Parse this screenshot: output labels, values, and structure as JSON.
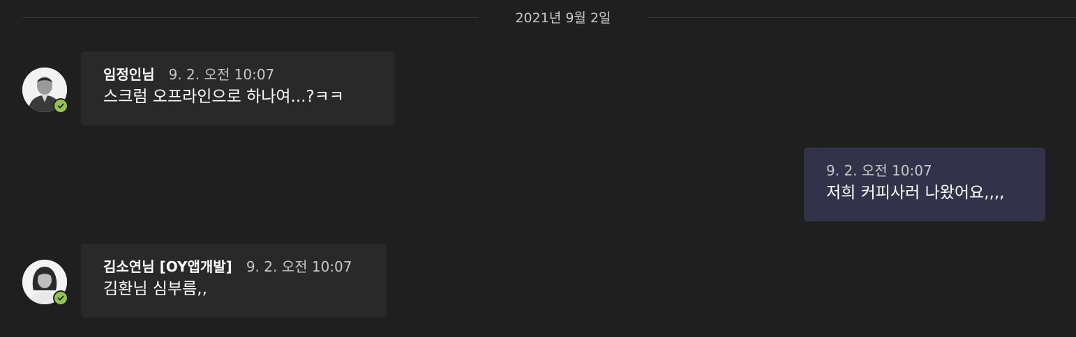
{
  "date_divider": "2021년 9월 2일",
  "messages": [
    {
      "sender": "임정인님",
      "time": "9. 2. 오전 10:07",
      "text": "스크럼 오프라인으로 하나여...?ㅋㅋ",
      "presence": "available"
    },
    {
      "sender": "",
      "time": "9. 2. 오전 10:07",
      "text": "저희 커피사러 나왔어요,,,,"
    },
    {
      "sender": "김소연님 [OY앱개발]",
      "time": "9. 2. 오전 10:07",
      "text": "김환님 심부름,,",
      "presence": "available"
    }
  ],
  "colors": {
    "background": "#1f1f1f",
    "incoming_bubble": "#292929",
    "outgoing_bubble": "#32324a",
    "presence_available": "#92c353"
  },
  "icons": [
    "avatar-photo",
    "check-icon"
  ]
}
